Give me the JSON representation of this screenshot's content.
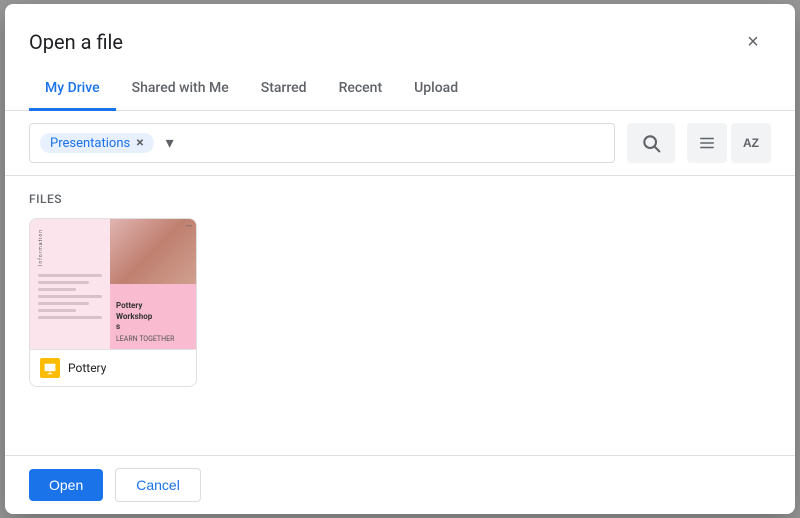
{
  "dialog": {
    "title": "Open a file",
    "close_label": "×"
  },
  "tabs": [
    {
      "id": "my-drive",
      "label": "My Drive",
      "active": true
    },
    {
      "id": "shared",
      "label": "Shared with Me",
      "active": false
    },
    {
      "id": "starred",
      "label": "Starred",
      "active": false
    },
    {
      "id": "recent",
      "label": "Recent",
      "active": false
    },
    {
      "id": "upload",
      "label": "Upload",
      "active": false
    }
  ],
  "toolbar": {
    "filter_chip_label": "Presentations",
    "filter_chip_remove": "×",
    "search_icon": "🔍",
    "list_icon": "≡",
    "sort_icon": "AZ"
  },
  "content": {
    "section_label": "Files",
    "files": [
      {
        "id": "pottery",
        "name": "Pottery",
        "icon_color": "#FBBC04",
        "thumbnail_title": "Pottery Workshops",
        "thumbnail_subtitle": "LEARN TOGETHER",
        "thumb_text": "Information"
      }
    ]
  },
  "footer": {
    "open_label": "Open",
    "cancel_label": "Cancel"
  }
}
